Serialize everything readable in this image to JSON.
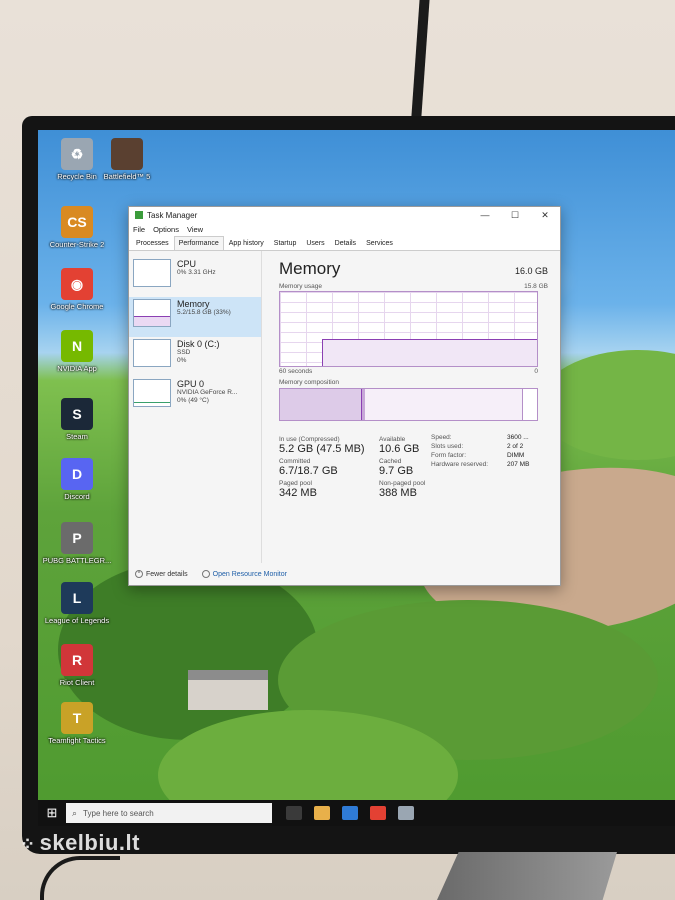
{
  "desktop": {
    "icons": [
      {
        "label": "Recycle Bin",
        "glyph": "♻",
        "color": "#9aa6b2"
      },
      {
        "label": "Battlefield™ 5",
        "glyph": "",
        "color": "#5a4030"
      },
      {
        "label": "Counter-Strike 2",
        "glyph": "CS",
        "color": "#d98a22"
      },
      {
        "label": "Google Chrome",
        "glyph": "◉",
        "color": "#e34133"
      },
      {
        "label": "NVIDIA App",
        "glyph": "N",
        "color": "#76b900"
      },
      {
        "label": "Steam",
        "glyph": "S",
        "color": "#1b2838"
      },
      {
        "label": "Discord",
        "glyph": "D",
        "color": "#5865f2"
      },
      {
        "label": "PUBG BATTLEGR...",
        "glyph": "P",
        "color": "#6b6b6b"
      },
      {
        "label": "League of Legends",
        "glyph": "L",
        "color": "#1e3a5a"
      },
      {
        "label": "Riot Client",
        "glyph": "R",
        "color": "#d13639"
      },
      {
        "label": "Teamfight Tactics",
        "glyph": "T",
        "color": "#c9a227"
      }
    ]
  },
  "taskmanager": {
    "title": "Task Manager",
    "window_buttons": {
      "minimize": "—",
      "maximize": "☐",
      "close": "✕"
    },
    "menu": [
      "File",
      "Options",
      "View"
    ],
    "tabs": [
      "Processes",
      "Performance",
      "App history",
      "Startup",
      "Users",
      "Details",
      "Services"
    ],
    "sidebar": [
      {
        "name": "CPU",
        "sub1": "0% 3.31 GHz",
        "sub2": ""
      },
      {
        "name": "Memory",
        "sub1": "5.2/15.8 GB (33%)",
        "sub2": ""
      },
      {
        "name": "Disk 0 (C:)",
        "sub1": "SSD",
        "sub2": "0%"
      },
      {
        "name": "GPU 0",
        "sub1": "NVIDIA GeForce R...",
        "sub2": "0% (49 °C)"
      }
    ],
    "detail": {
      "title": "Memory",
      "total": "16.0 GB",
      "usage_label": "Memory usage",
      "usage_max": "15.8 GB",
      "axis_left": "60 seconds",
      "axis_right": "0",
      "composition_label": "Memory composition",
      "in_use_label": "In use (Compressed)",
      "in_use_value": "5.2 GB (47.5 MB)",
      "available_label": "Available",
      "available_value": "10.6 GB",
      "committed_label": "Committed",
      "committed_value": "6.7/18.7 GB",
      "cached_label": "Cached",
      "cached_value": "9.7 GB",
      "paged_label": "Paged pool",
      "paged_value": "342 MB",
      "nonpaged_label": "Non-paged pool",
      "nonpaged_value": "388 MB",
      "props": [
        {
          "k": "Speed:",
          "v": "3600 ..."
        },
        {
          "k": "Slots used:",
          "v": "2 of 2"
        },
        {
          "k": "Form factor:",
          "v": "DIMM"
        },
        {
          "k": "Hardware reserved:",
          "v": "207 MB"
        }
      ]
    },
    "footer": {
      "fewer": "Fewer details",
      "resmon": "Open Resource Monitor"
    }
  },
  "taskbar": {
    "start_glyph": "⊞",
    "search_placeholder": "Type here to search",
    "apps": [
      "#3a3a3a",
      "#e8b04a",
      "#2f7bd6",
      "#e34133",
      "#9aa6b2"
    ]
  },
  "watermark": "skelbiu.lt"
}
